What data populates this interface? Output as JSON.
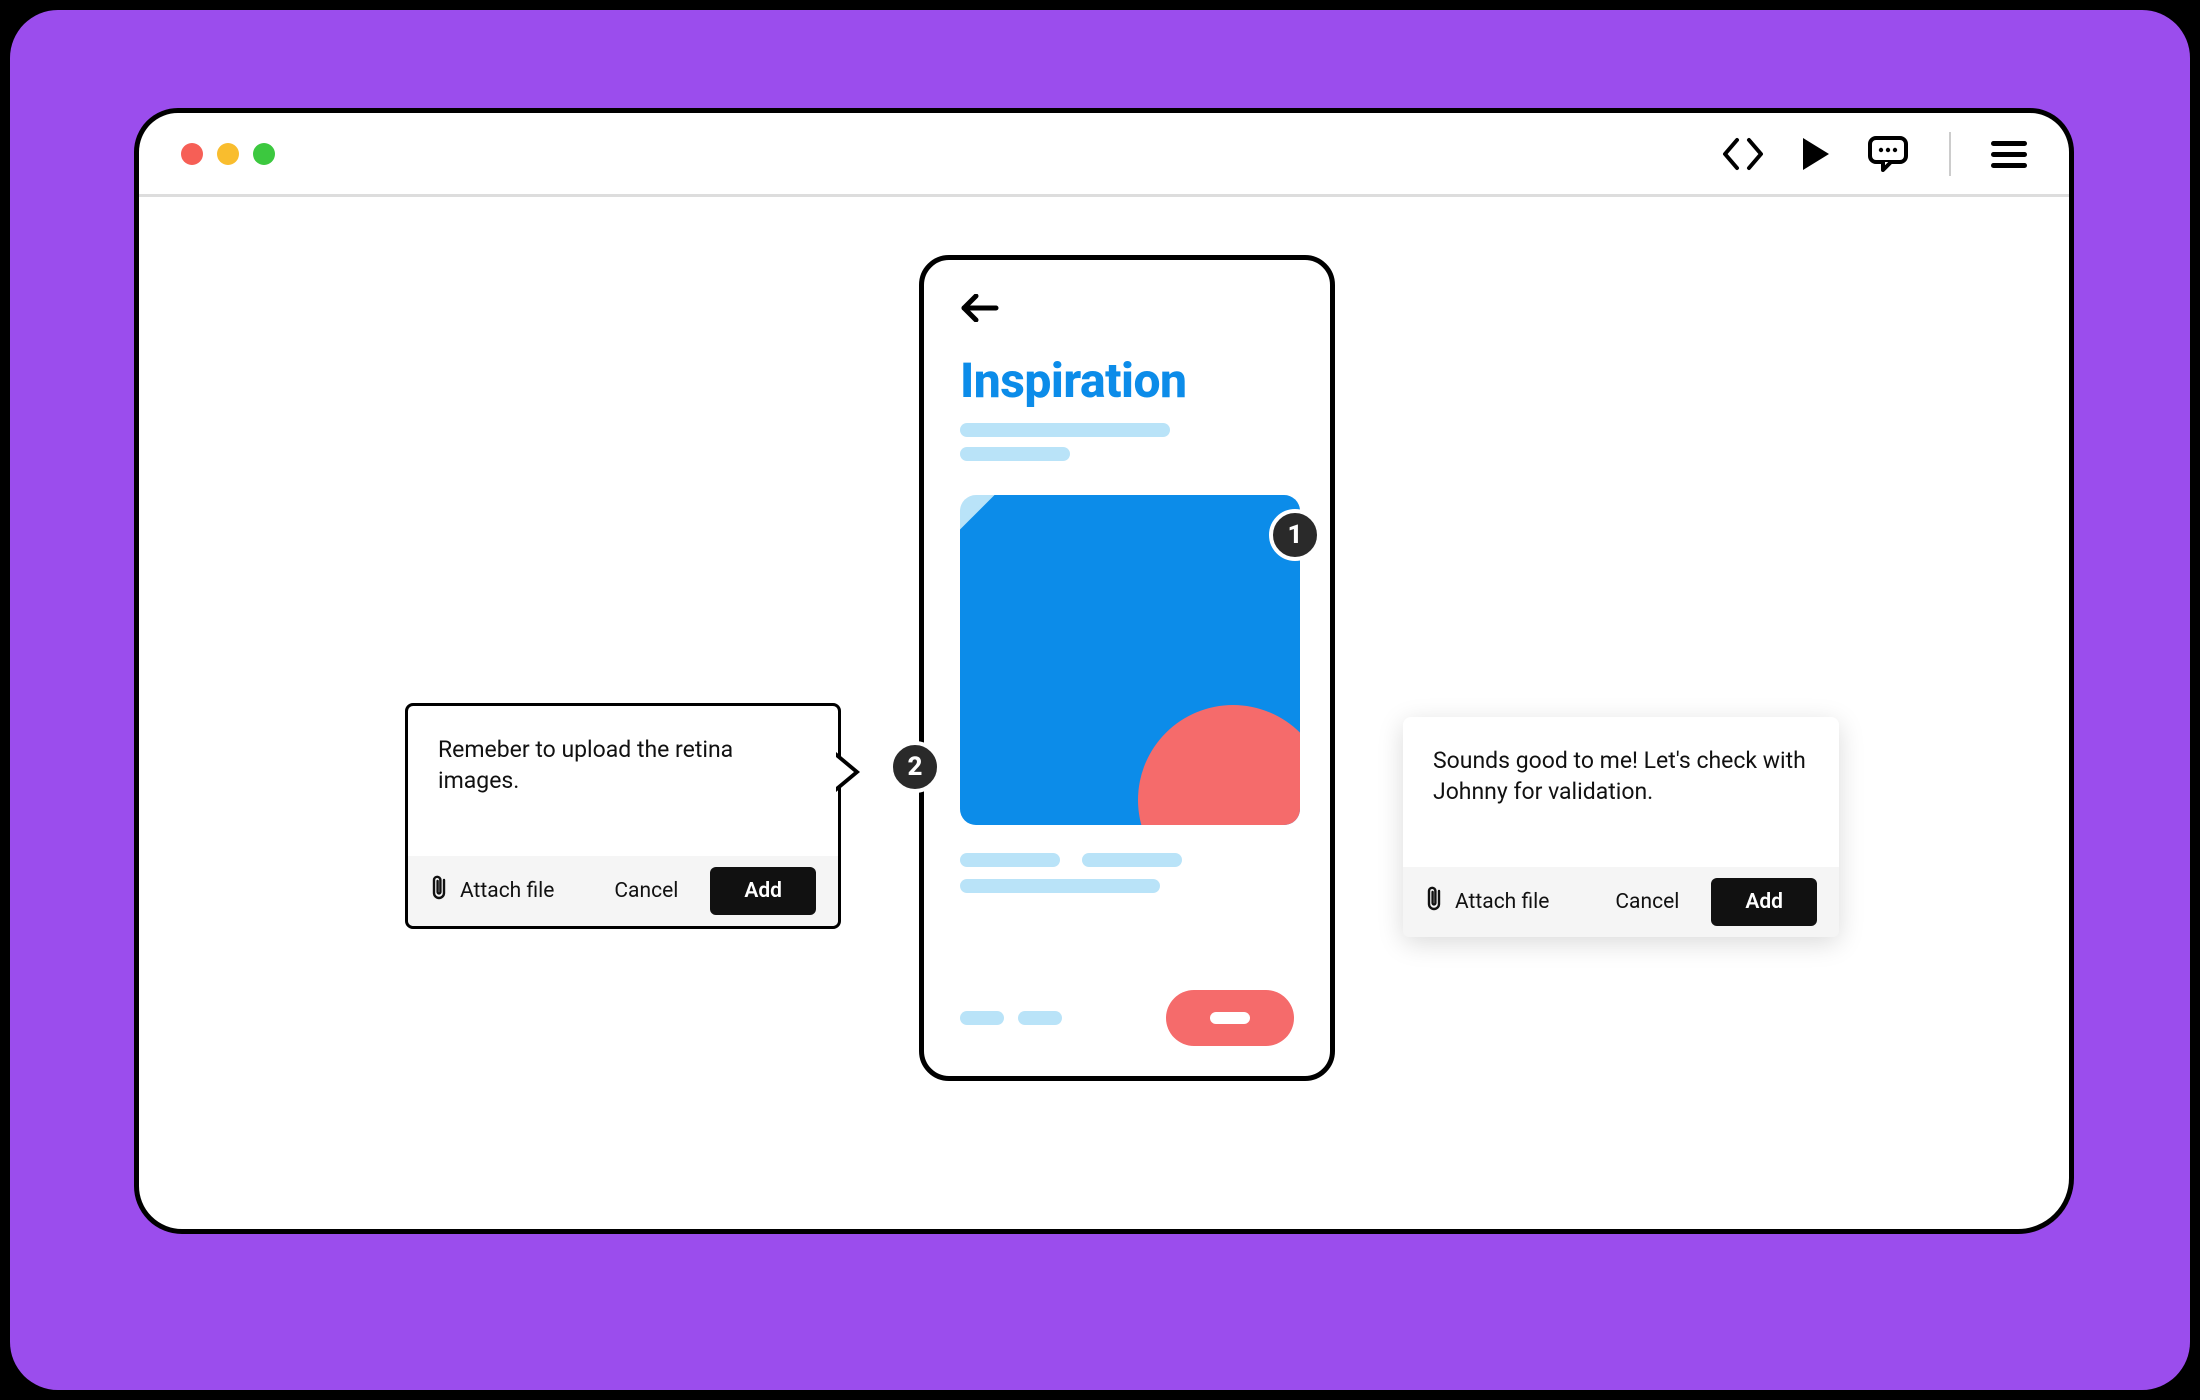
{
  "colors": {
    "background_purple": "#9B4DED",
    "accent_blue": "#0C8CE9",
    "light_blue": "#B9E3F8",
    "coral": "#F56B6B",
    "badge_bg": "#2A2A2A"
  },
  "traffic_lights": {
    "red": "#F65F56",
    "yellow": "#F9BD2E",
    "green": "#3CC83F"
  },
  "toolbar_icons": [
    "code-icon",
    "play-icon",
    "chat-icon",
    "menu-icon"
  ],
  "phone": {
    "title": "Inspiration"
  },
  "annotations": {
    "badge_1": "1",
    "badge_2": "2"
  },
  "comments": {
    "left": {
      "text": "Remeber to upload the retina images.",
      "attach_label": "Attach file",
      "cancel_label": "Cancel",
      "add_label": "Add"
    },
    "right": {
      "text": "Sounds good to me! Let's check with Johnny for validation.",
      "attach_label": "Attach file",
      "cancel_label": "Cancel",
      "add_label": "Add"
    }
  }
}
